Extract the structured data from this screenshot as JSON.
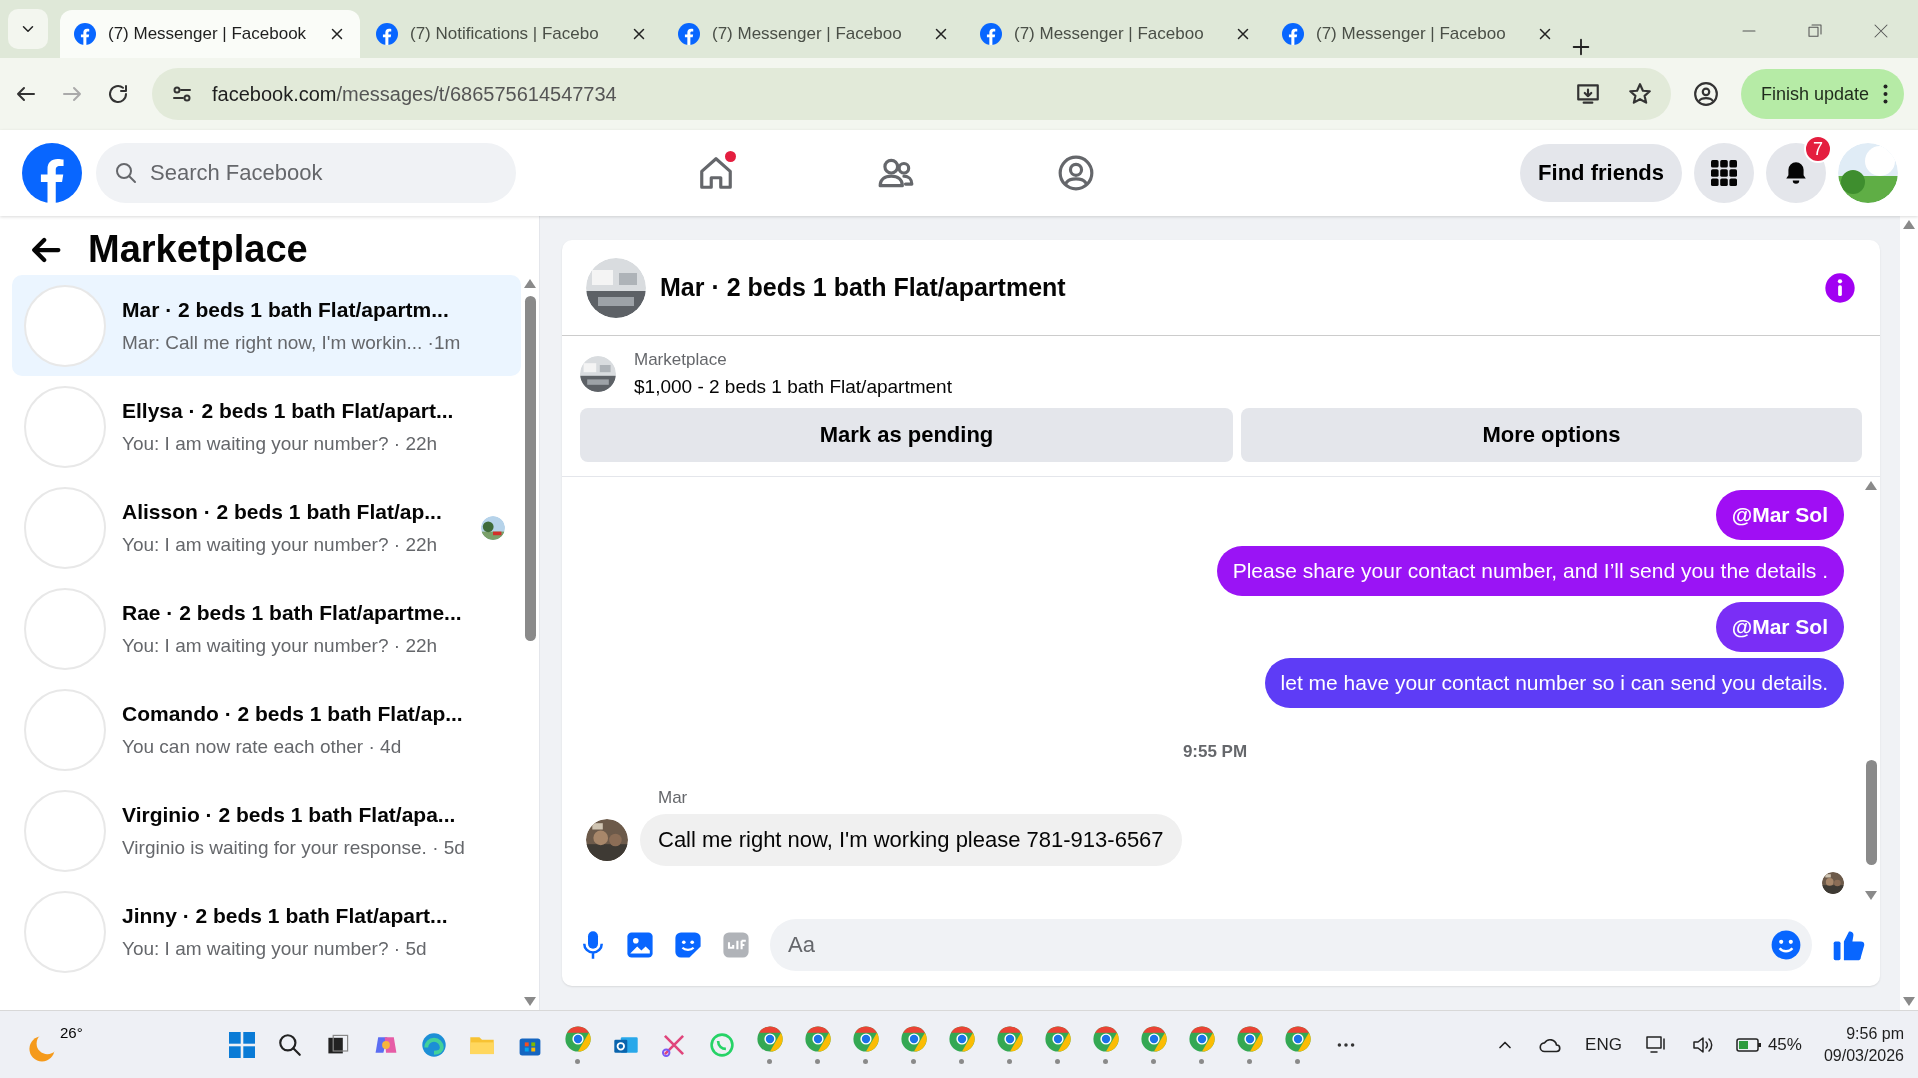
{
  "browser": {
    "tabs": [
      {
        "title": "(7) Messenger | Facebook",
        "selected": true
      },
      {
        "title": "(7) Notifications | Facebo",
        "selected": false
      },
      {
        "title": "(7) Messenger | Faceboo",
        "selected": false
      },
      {
        "title": "(7) Messenger | Faceboo",
        "selected": false
      },
      {
        "title": "(7) Messenger | Faceboo",
        "selected": false
      }
    ],
    "url_host": "facebook.com",
    "url_path": "/messages/t/686575614547734",
    "update_button": "Finish update"
  },
  "header": {
    "search": {
      "placeholder": "Search Facebook"
    },
    "nav": [
      {
        "kind": "home",
        "dot": true
      },
      {
        "kind": "friends",
        "dot": false
      },
      {
        "kind": "groups",
        "dot": false
      }
    ],
    "find_friends": "Find friends",
    "notification_count": "7"
  },
  "sidebar": {
    "title": "Marketplace",
    "items": [
      {
        "title": "Mar · 2 beds 1 bath Flat/apartm...",
        "preview": "Mar: Call me right now, I'm workin... ·1m",
        "selected": true,
        "seen_avatar": false
      },
      {
        "title": "Ellysa · 2 beds 1 bath Flat/apart...",
        "preview": "You: I am waiting your number? · 22h",
        "selected": false,
        "seen_avatar": false
      },
      {
        "title": "Alisson · 2 beds 1 bath Flat/ap...",
        "preview": "You: I am waiting your number? · 22h",
        "selected": false,
        "seen_avatar": true
      },
      {
        "title": "Rae · 2 beds 1 bath Flat/apartme...",
        "preview": "You: I am waiting your number? · 22h",
        "selected": false,
        "seen_avatar": false
      },
      {
        "title": "Comando · 2 beds 1 bath Flat/ap...",
        "preview": "You can now rate each other · 4d",
        "selected": false,
        "seen_avatar": false
      },
      {
        "title": "Virginio · 2 beds 1 bath Flat/apa...",
        "preview": "Virginio is waiting for your response. · 5d",
        "selected": false,
        "seen_avatar": false
      },
      {
        "title": "Jinny · 2 beds 1 bath Flat/apart...",
        "preview": "You: I am waiting your number? · 5d",
        "selected": false,
        "seen_avatar": false
      }
    ]
  },
  "chat": {
    "title": "Mar · 2 beds 1 bath Flat/apartment",
    "listing": {
      "label": "Marketplace",
      "text": "$1,000 - 2 beds 1 bath Flat/apartment"
    },
    "actions": [
      "Mark as pending",
      "More options"
    ],
    "messages": [
      {
        "kind": "mention",
        "text": "@Mar Sol",
        "color": "#a00ef4"
      },
      {
        "kind": "outgoing",
        "text": "Please share your contact number, and I’ll send you the details .",
        "color": "#9a14f5"
      },
      {
        "kind": "mention",
        "text": "@Mar Sol",
        "color": "#7a2ef6"
      },
      {
        "kind": "outgoing",
        "text": "let me have your contact number so i can send you details.",
        "color": "#5e3cf6"
      },
      {
        "kind": "time",
        "text": "9:55 PM"
      },
      {
        "kind": "incoming",
        "sender": "Mar",
        "text": "Call me right now, I'm working please 781-913-6567"
      }
    ],
    "composer": {
      "placeholder": "Aa"
    }
  },
  "taskbar": {
    "weather": "26°",
    "language": "ENG",
    "battery": "45%",
    "time": "9:56 pm",
    "date": "09/03/2026"
  }
}
